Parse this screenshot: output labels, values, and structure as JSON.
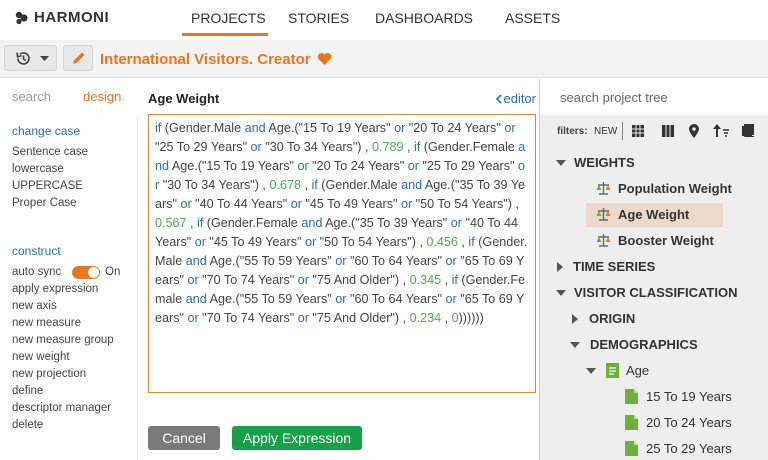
{
  "app": {
    "brand": "HARMONI"
  },
  "nav": {
    "tabs": [
      "PROJECTS",
      "STORIES",
      "DASHBOARDS",
      "ASSETS"
    ],
    "active": "PROJECTS"
  },
  "project": {
    "title": "International Visitors. Creator"
  },
  "left": {
    "tabs": {
      "search": "search",
      "design": "design"
    },
    "change_case": {
      "title": "change case",
      "items": [
        "Sentence case",
        "lowercase",
        "UPPERCASE",
        "Proper Case"
      ]
    },
    "construct": {
      "title": "construct",
      "auto_sync_label": "auto sync",
      "auto_sync_state": "On",
      "items": [
        "apply expression",
        "new axis",
        "new measure",
        "new measure group",
        "new weight",
        "new projection",
        "define",
        "descriptor manager",
        "delete"
      ]
    }
  },
  "editor": {
    "title": "Age Weight",
    "link": "editor",
    "cancel": "Cancel",
    "apply": "Apply Expression"
  },
  "tree": {
    "search_placeholder": "search project tree",
    "filters_label": "filters:",
    "filters_new": "NEW",
    "nodes": {
      "weights": "WEIGHTS",
      "population_weight": "Population Weight",
      "age_weight": "Age Weight",
      "booster_weight": "Booster Weight",
      "time_series": "TIME SERIES",
      "visitor_classification": "VISITOR CLASSIFICATION",
      "origin": "ORIGIN",
      "demographics": "DEMOGRAPHICS",
      "age": "Age",
      "age_15_19": "15 To 19 Years",
      "age_20_24": "20 To 24 Years",
      "age_25_29": "25 To 29 Years"
    }
  },
  "colors": {
    "accent": "#e87722",
    "link": "#2a6eb0",
    "apply": "#16a04a",
    "number": "#4caf50"
  }
}
